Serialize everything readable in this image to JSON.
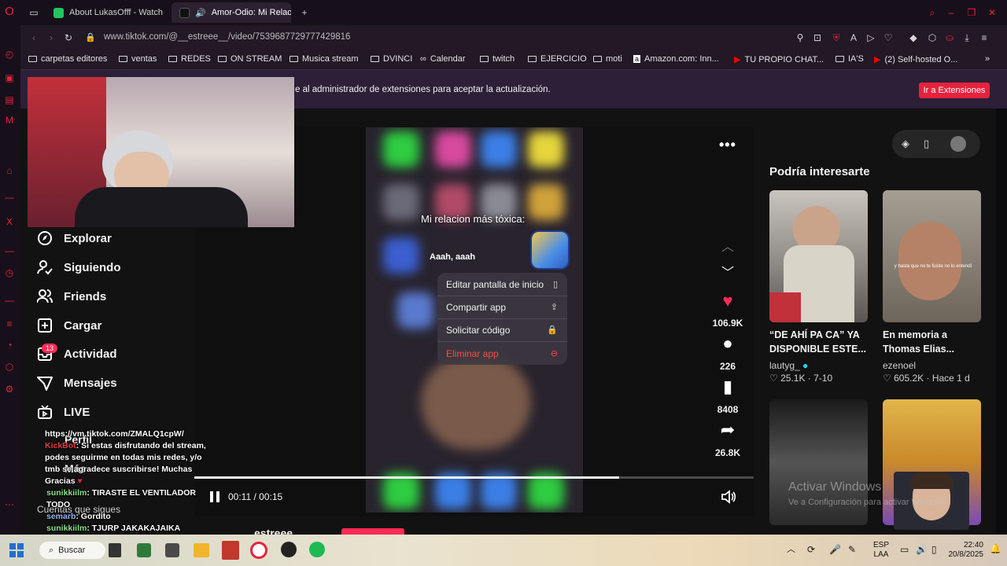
{
  "browser": {
    "tabs": [
      {
        "title": "About LukasOfff - Watch",
        "favicon": "twitch-icon"
      },
      {
        "title": "Amor-Odio: Mi Relaci",
        "favicon": "tiktok-icon",
        "active": true
      }
    ],
    "url": "www.tiktok.com/@__estreee__/video/7539687729777429816",
    "bookmarks": [
      "carpetas editores",
      "ventas",
      "REDES",
      "ON STREAM",
      "Musica stream",
      "DVINCI",
      "Calendar",
      "twitch",
      "EJERCICIO",
      "moti",
      "Amazon.com: Inn...",
      "TU PROPIO CHAT...",
      "IA'S",
      "(2) Self-hosted O..."
    ],
    "notice": {
      "text": "e al administrador de extensiones para aceptar la actualización.",
      "button": "Ir a Extensiones"
    }
  },
  "nav": {
    "items": [
      "Explorar",
      "Siguiendo",
      "Friends",
      "Cargar",
      "Actividad",
      "Mensajes",
      "LIVE",
      "Perfil",
      "Más"
    ],
    "activity_badge": "13",
    "following_label": "Cuentas que sigues"
  },
  "video": {
    "caption": "Mi relacion más tóxica:",
    "app_label": "Aaah, aaah",
    "menu": [
      {
        "label": "Editar pantalla de inicio",
        "icon": "phone-icon"
      },
      {
        "label": "Compartir app",
        "icon": "share-icon"
      },
      {
        "label": "Solicitar código",
        "icon": "lock-icon"
      },
      {
        "label": "Eliminar app",
        "icon": "minus-circle-icon"
      }
    ],
    "likes": "106.9K",
    "comments": "226",
    "saves": "8408",
    "shares": "26.8K",
    "time": "00:11 / 00:15",
    "progress": 0.76,
    "creator": "estreee"
  },
  "recommendations": {
    "title": "Podría interesarte",
    "cards": [
      {
        "title": "“DE AHÍ PA CA” YA DISPONIBLE ESTE...",
        "author": "lautyg_",
        "likes": "25.1K",
        "date": "7-10"
      },
      {
        "title": "En memoria a Thomas Elias...",
        "author": "ezenoel",
        "likes": "605.2K",
        "date": "Hace 1 d"
      }
    ],
    "thumb_caption": "y hasta que no te fuiste no lo entendí"
  },
  "chat": {
    "link": "https://vm.tiktok.com/ZMALQ1cpW/",
    "bot_name": "KickBot",
    "bot_message": ": Si estas disfrutando del stream, podes seguirme en todas mis redes, y/o tmb se agradece suscribirse! Muchas Gracias",
    "messages": [
      {
        "user": "sunikkiilm",
        "text": ": TIRASTE EL VENTILADOR TODO"
      },
      {
        "user": "semarb",
        "text": ": Gordito"
      },
      {
        "user": "sunikkiilm",
        "text": ": TJURP JAKAKAJAIKA"
      }
    ]
  },
  "watermark": {
    "line1": "Activar Windows",
    "line2": "Ve a Configuración para activar Windows."
  },
  "taskbar": {
    "search": "Buscar",
    "language": "ESP",
    "layout": "LAA",
    "time": "22:40",
    "date": "20/8/2025"
  },
  "colors": {
    "accent": "#fe2c55",
    "opera_red": "#e6223d"
  }
}
